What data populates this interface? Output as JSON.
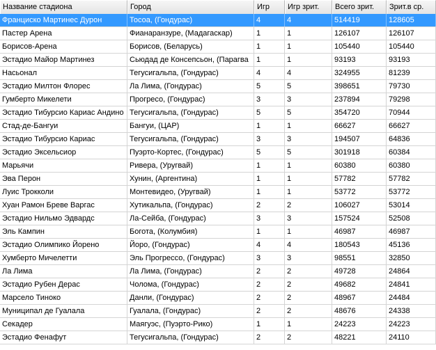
{
  "table": {
    "columns": [
      "Название стадиона",
      "Город",
      "Игр",
      "Игр зрит.",
      "Всего зрит.",
      "Зрит.в ср."
    ],
    "selected_row": 0,
    "rows": [
      [
        "Франциско Мартинес Дурон",
        "Тосоа, (Гондурас)",
        "4",
        "4",
        "514419",
        "128605"
      ],
      [
        "Пастер Арена",
        "Фианаранзуре, (Мадагаскар)",
        "1",
        "1",
        "126107",
        "126107"
      ],
      [
        "Борисов-Арена",
        "Борисов, (Беларусь)",
        "1",
        "1",
        "105440",
        "105440"
      ],
      [
        "Эстадио Майор Мартинез",
        "Сьюдад де Консепсьон, (Парагва",
        "1",
        "1",
        "93193",
        "93193"
      ],
      [
        "Насьонал",
        "Тегусигальпа, (Гондурас)",
        "4",
        "4",
        "324955",
        "81239"
      ],
      [
        "Эстадио Милтон Флорес",
        "Ла Лима, (Гондурас)",
        "5",
        "5",
        "398651",
        "79730"
      ],
      [
        "Гумберто Микелети",
        "Прогресо, (Гондурас)",
        "3",
        "3",
        "237894",
        "79298"
      ],
      [
        "Эстадио Тибурсио Кариас Андино",
        "Тегусигальпа, (Гондурас)",
        "5",
        "5",
        "354720",
        "70944"
      ],
      [
        "Стад-де-Бангуи",
        "Бангуи, (ЦАР)",
        "1",
        "1",
        "66627",
        "66627"
      ],
      [
        "Эстадио Тибурсио Кариас",
        "Тегусигальпа, (Гондурас)",
        "3",
        "3",
        "194507",
        "64836"
      ],
      [
        "Эстадио Эксельсиор",
        "Пуэрто-Кортес, (Гондурас)",
        "5",
        "5",
        "301918",
        "60384"
      ],
      [
        "Марьячи",
        "Ривера, (Уругвай)",
        "1",
        "1",
        "60380",
        "60380"
      ],
      [
        "Эва Перон",
        "Хунин, (Аргентина)",
        "1",
        "1",
        "57782",
        "57782"
      ],
      [
        "Луис Трокколи",
        "Монтевидео, (Уругвай)",
        "1",
        "1",
        "53772",
        "53772"
      ],
      [
        "Хуан Рамон Бреве Варгас",
        "Хутикальпа, (Гондурас)",
        "2",
        "2",
        "106027",
        "53014"
      ],
      [
        "Эстадио Нильмо Эдвардс",
        "Ла-Сейба, (Гондурас)",
        "3",
        "3",
        "157524",
        "52508"
      ],
      [
        "Эль Кампин",
        "Богота, (Колумбия)",
        "1",
        "1",
        "46987",
        "46987"
      ],
      [
        "Эстадио Олимпико Йорено",
        "Йоро, (Гондурас)",
        "4",
        "4",
        "180543",
        "45136"
      ],
      [
        "Хумберто Мичелетти",
        "Эль Прогрессо, (Гондурас)",
        "3",
        "3",
        "98551",
        "32850"
      ],
      [
        "Ла Лима",
        "Ла Лима, (Гондурас)",
        "2",
        "2",
        "49728",
        "24864"
      ],
      [
        "Эстадио Рубен Дерас",
        "Чолома, (Гондурас)",
        "2",
        "2",
        "49682",
        "24841"
      ],
      [
        "Марсело Тиноко",
        "Данли, (Гондурас)",
        "2",
        "2",
        "48967",
        "24484"
      ],
      [
        "Муниципал де Гуалала",
        "Гуалала, (Гондурас)",
        "2",
        "2",
        "48676",
        "24338"
      ],
      [
        "Секадер",
        "Маягуэс, (Пуэрто-Рико)",
        "1",
        "1",
        "24223",
        "24223"
      ],
      [
        "Эстадио Фенафут",
        "Тегусигальпа, (Гондурас)",
        "2",
        "2",
        "48221",
        "24110"
      ]
    ]
  }
}
